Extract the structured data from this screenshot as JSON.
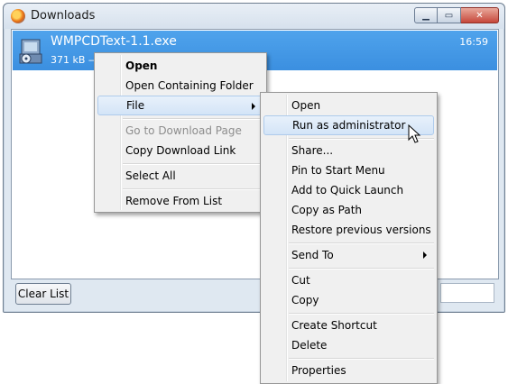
{
  "window": {
    "title": "Downloads",
    "controls": {
      "minimize": "▁",
      "maximize": "▭",
      "close": "✕"
    }
  },
  "download": {
    "file_name": "WMPCDText-1.1.exe",
    "status": "371 kB —",
    "time": "16:59"
  },
  "footer": {
    "clear_list": "Clear List"
  },
  "context_menu": {
    "items": [
      {
        "label": "Open"
      },
      {
        "label": "Open Containing Folder"
      },
      {
        "label": "File"
      },
      {
        "label": "Go to Download Page"
      },
      {
        "label": "Copy Download Link"
      },
      {
        "label": "Select All"
      },
      {
        "label": "Remove From List"
      }
    ]
  },
  "file_submenu": {
    "items": [
      {
        "label": "Open"
      },
      {
        "label": "Run as administrator"
      },
      {
        "label": "Share..."
      },
      {
        "label": "Pin to Start Menu"
      },
      {
        "label": "Add to Quick Launch"
      },
      {
        "label": "Copy as Path"
      },
      {
        "label": "Restore previous versions"
      },
      {
        "label": "Send To"
      },
      {
        "label": "Cut"
      },
      {
        "label": "Copy"
      },
      {
        "label": "Create Shortcut"
      },
      {
        "label": "Delete"
      },
      {
        "label": "Properties"
      }
    ]
  },
  "colors": {
    "selection": "#3b8fe0",
    "menu_background": "#f0f0f0",
    "menu_highlight": "#d3e4f7"
  }
}
